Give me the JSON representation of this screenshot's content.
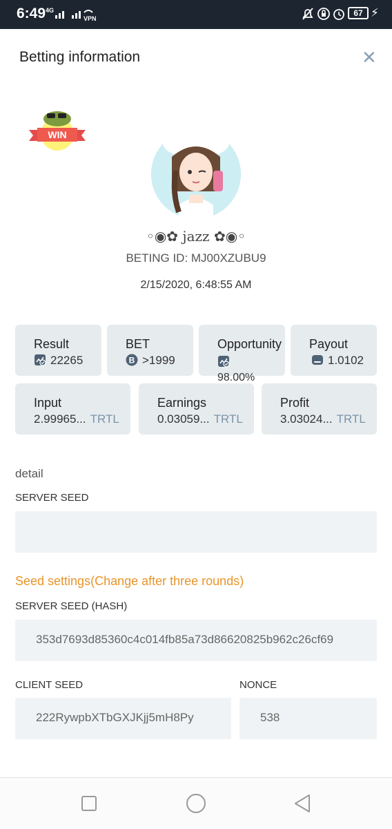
{
  "status_bar": {
    "time": "6:49",
    "network": "4G",
    "vpn": "VPN",
    "battery": "67",
    "icons": [
      "signal-icon",
      "vpn-icon",
      "mute-icon",
      "lock-rotate-icon",
      "alarm-icon",
      "battery-icon",
      "charging-icon"
    ]
  },
  "header": {
    "title": "Betting information",
    "close_icon": "close-icon"
  },
  "badge": {
    "text": "WIN"
  },
  "user": {
    "nickname": "◦◉✿ jazz ✿◉◦",
    "bet_id": "BETING ID: MJ00XZUBU9",
    "datetime": "2/15/2020, 6:48:55 AM"
  },
  "stats": [
    {
      "label": "Result",
      "value": "22265",
      "icon": "result-icon"
    },
    {
      "label": "BET",
      "value": ">1999",
      "icon": "bitcoin-icon"
    },
    {
      "label": "Opportunity",
      "value": "98.00%",
      "icon": "chance-icon"
    },
    {
      "label": "Payout",
      "value": "1.0102",
      "icon": "payout-icon"
    }
  ],
  "amounts": [
    {
      "label": "Input",
      "value": "2.99965...",
      "unit": "TRTL"
    },
    {
      "label": "Earnings",
      "value": "0.03059...",
      "unit": "TRTL"
    },
    {
      "label": "Profit",
      "value": "3.03024...",
      "unit": "TRTL"
    }
  ],
  "detail": {
    "heading": "detail",
    "server_seed_label": "SERVER SEED",
    "server_seed_value": "",
    "seed_settings": "Seed settings(Change after three rounds)",
    "server_seed_hash_label": "SERVER SEED (HASH)",
    "server_seed_hash_value": "353d7693d85360c4c014fb85a73d86620825b962c26cf69",
    "client_seed_label": "CLIENT SEED",
    "client_seed_value": "222RywpbXTbGXJKjj5mH8Py",
    "nonce_label": "NONCE",
    "nonce_value": "538"
  },
  "nav": {
    "icons": [
      "recent-apps-icon",
      "home-icon",
      "back-icon"
    ]
  },
  "colors": {
    "accent_orange": "#e8942a",
    "card_bg": "#e6ebee",
    "unit_blue": "#7b93a8",
    "status_bar": "#1c2530"
  }
}
